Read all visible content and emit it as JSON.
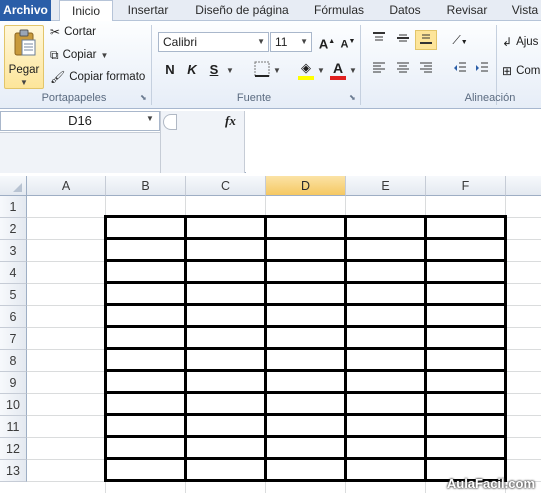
{
  "tabs": [
    "Archivo",
    "Inicio",
    "Insertar",
    "Diseño de página",
    "Fórmulas",
    "Datos",
    "Revisar",
    "Vista"
  ],
  "clipboard": {
    "paste_label": "Pegar",
    "cut_label": "Cortar",
    "copy_label": "Copiar",
    "format_painter_label": "Copiar formato",
    "group_label": "Portapapeles"
  },
  "font": {
    "name": "Calibri",
    "size": "11",
    "bold": "N",
    "italic": "K",
    "underline": "S",
    "grow_label": "A",
    "shrink_label": "A",
    "color_label": "A",
    "group_label": "Fuente"
  },
  "alignment": {
    "wrap_label": "Ajus",
    "merge_label": "Com",
    "group_label": "Alineación"
  },
  "formula_bar": {
    "name_box": "D16",
    "fx_label": "fx",
    "formula": ""
  },
  "sheet": {
    "columns": [
      "A",
      "B",
      "C",
      "D",
      "E",
      "F"
    ],
    "selected_column": "D",
    "rows": [
      "1",
      "2",
      "3",
      "4",
      "5",
      "6",
      "7",
      "8",
      "9",
      "10",
      "11",
      "12",
      "13"
    ]
  },
  "watermark": "AulaFacil.com",
  "colors": {
    "file_tab": "#2a5ea8",
    "selected_header": "#f5c862",
    "font_color_bar": "#e02020",
    "highlight_bar": "#ffff00"
  }
}
